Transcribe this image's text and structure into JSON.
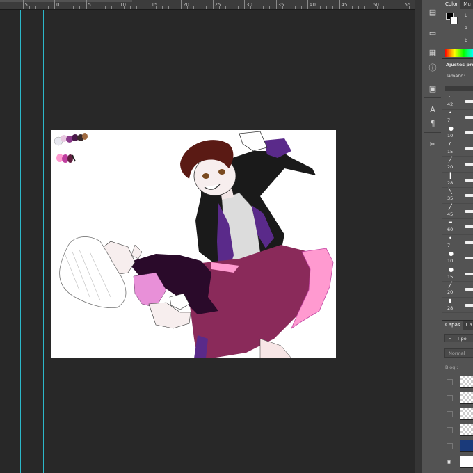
{
  "ruler": {
    "labels": [
      "5",
      "0",
      "5",
      "10",
      "15",
      "20",
      "25",
      "30",
      "35",
      "40",
      "45",
      "50",
      "55"
    ]
  },
  "color_panel": {
    "tabs": [
      "Color",
      "Mu"
    ],
    "channel_l": "L",
    "channel_a": "a",
    "channel_b": "b"
  },
  "adjustments_panel": {
    "title": "Ajustes prec",
    "size_label": "Tamaño:"
  },
  "brushes": [
    {
      "size": "42"
    },
    {
      "size": "7"
    },
    {
      "size": "10"
    },
    {
      "size": "15"
    },
    {
      "size": "20"
    },
    {
      "size": "28"
    },
    {
      "size": "35"
    },
    {
      "size": "45"
    },
    {
      "size": "60"
    },
    {
      "size": "7"
    },
    {
      "size": "10"
    },
    {
      "size": "15"
    },
    {
      "size": "20"
    },
    {
      "size": "28"
    }
  ],
  "layers_panel": {
    "tabs": [
      "Capas",
      "Ca"
    ],
    "filter_label": "Tipo",
    "blend_mode": "Normal",
    "lock_label": "Bloq.:"
  },
  "colors": {
    "foreground": "#000000",
    "background": "#ffffff",
    "guide": "#2cb7c9"
  },
  "artwork": {
    "palette_swatches": [
      "#3a2a2a",
      "#a06a40",
      "#e8c8e0",
      "#4a1a4a",
      "#8a3a8a",
      "#ff9ad0",
      "#c040a0",
      "#602040"
    ]
  }
}
